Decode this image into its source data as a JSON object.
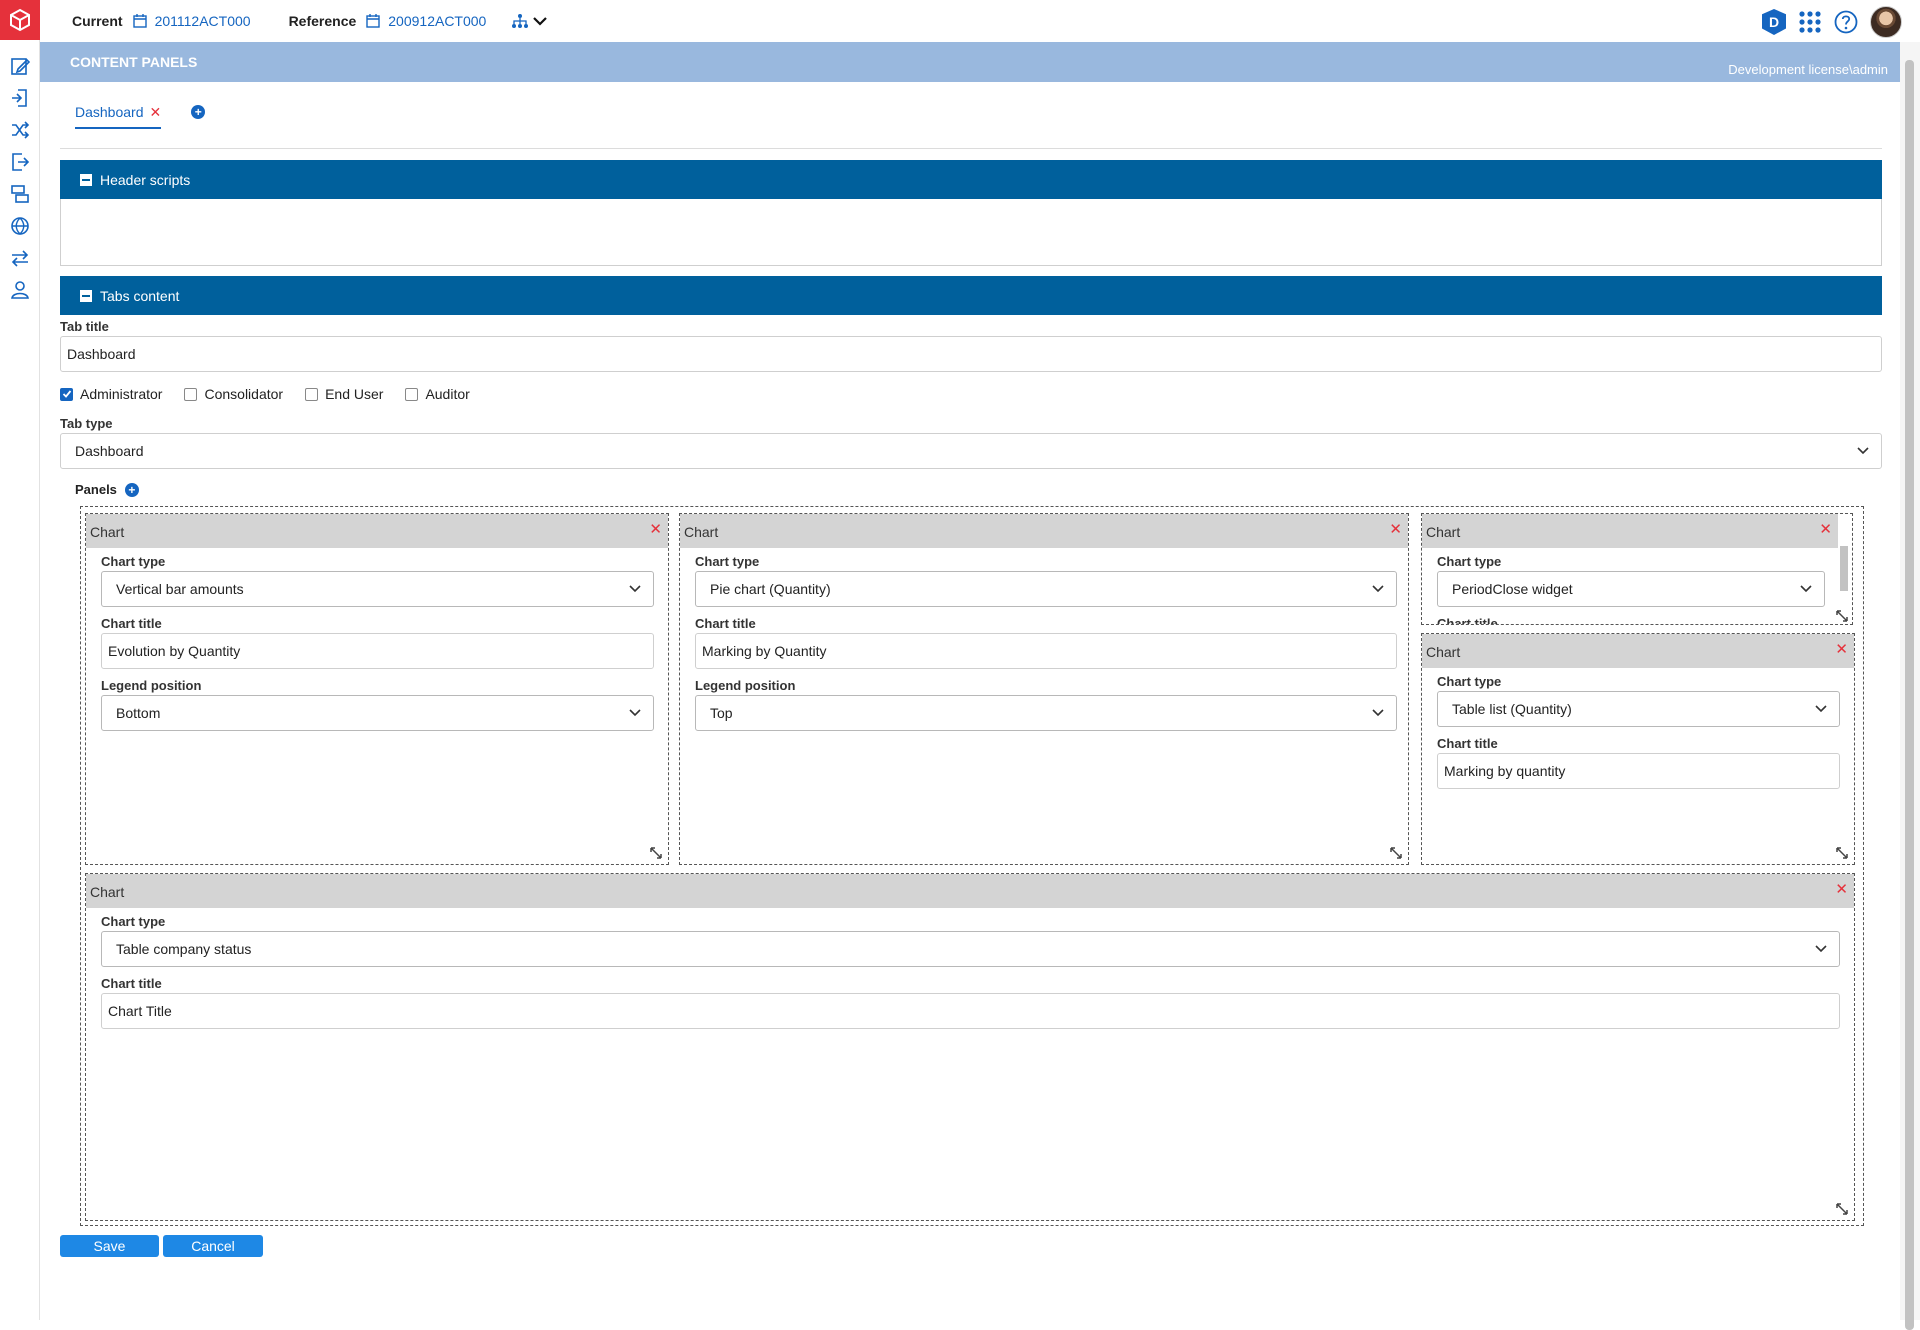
{
  "topbar": {
    "current_label": "Current",
    "current_value": "201112ACT000",
    "reference_label": "Reference",
    "reference_value": "200912ACT000",
    "badge_letter": "D"
  },
  "band": {
    "title": "CONTENT PANELS",
    "license": "Development license\\admin"
  },
  "tabs": [
    {
      "label": "Dashboard",
      "active": true
    }
  ],
  "header_scripts": {
    "title": "Header scripts",
    "value": ""
  },
  "tabs_content": {
    "title": "Tabs content",
    "tab_title_label": "Tab title",
    "tab_title_value": "Dashboard",
    "roles": [
      {
        "label": "Administrator",
        "checked": true
      },
      {
        "label": "Consolidator",
        "checked": false
      },
      {
        "label": "End User",
        "checked": false
      },
      {
        "label": "Auditor",
        "checked": false
      }
    ],
    "tab_type_label": "Tab type",
    "tab_type_value": "Dashboard"
  },
  "panels": {
    "label": "Panels",
    "items": [
      {
        "header": "Chart",
        "chart_type_label": "Chart type",
        "chart_type": "Vertical bar amounts",
        "chart_title_label": "Chart title",
        "chart_title": "Evolution by Quantity",
        "legend_label": "Legend position",
        "legend": "Bottom"
      },
      {
        "header": "Chart",
        "chart_type_label": "Chart type",
        "chart_type": "Pie chart (Quantity)",
        "chart_title_label": "Chart title",
        "chart_title": "Marking by Quantity",
        "legend_label": "Legend position",
        "legend": "Top"
      },
      {
        "header": "Chart",
        "chart_type_label": "Chart type",
        "chart_type": "PeriodClose widget",
        "chart_title_label": "Chart title"
      },
      {
        "header": "Chart",
        "chart_type_label": "Chart type",
        "chart_type": "Table list (Quantity)",
        "chart_title_label": "Chart title",
        "chart_title": "Marking by quantity"
      },
      {
        "header": "Chart",
        "chart_type_label": "Chart type",
        "chart_type": "Table company status",
        "chart_title_label": "Chart title",
        "chart_title": "Chart Title"
      }
    ]
  },
  "actions": {
    "save": "Save",
    "cancel": "Cancel"
  },
  "colors": {
    "accent": "#1565c0",
    "section_header": "#00609c",
    "band": "#99b8de",
    "danger": "#e5313b"
  }
}
